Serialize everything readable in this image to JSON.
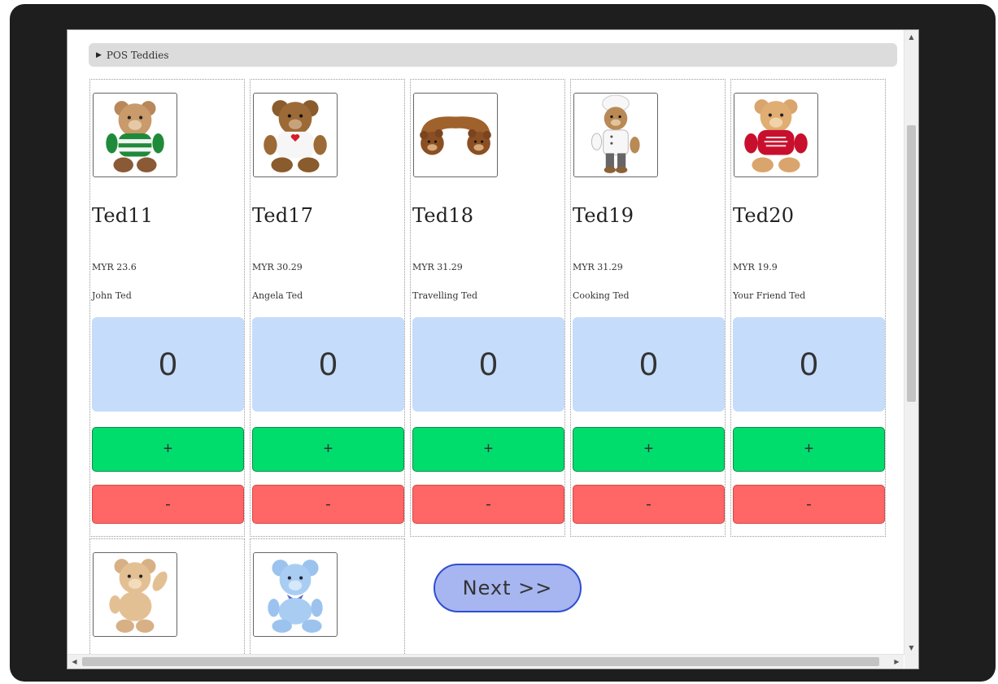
{
  "section": {
    "label": "POS Teddies",
    "toggle_icon": "triangle-right-icon"
  },
  "products": [
    {
      "name": "Ted11",
      "price": "MYR 23.6",
      "desc": "John Ted",
      "qty": "0",
      "plus": "+",
      "minus": "-",
      "image": "teddy-green-shirt"
    },
    {
      "name": "Ted17",
      "price": "MYR 30.29",
      "desc": "Angela Ted",
      "qty": "0",
      "plus": "+",
      "minus": "-",
      "image": "teddy-i-love-shirt"
    },
    {
      "name": "Ted18",
      "price": "MYR 31.29",
      "desc": "Travelling Ted",
      "qty": "0",
      "plus": "+",
      "minus": "-",
      "image": "teddy-neck-pillow"
    },
    {
      "name": "Ted19",
      "price": "MYR 31.29",
      "desc": "Cooking Ted",
      "qty": "0",
      "plus": "+",
      "minus": "-",
      "image": "teddy-chef"
    },
    {
      "name": "Ted20",
      "price": "MYR 19.9",
      "desc": "Your Friend Ted",
      "qty": "0",
      "plus": "+",
      "minus": "-",
      "image": "teddy-red-shirt"
    }
  ],
  "next_row_images": [
    "teddy-waving",
    "teddy-blue"
  ],
  "next_button": {
    "label": "Next >>"
  },
  "colors": {
    "qty_bg": "#c5dcfa",
    "plus_bg": "#00dd6d",
    "minus_bg": "#ff6666",
    "next_bg": "#a7b6f0",
    "next_border": "#2f4ed0"
  }
}
